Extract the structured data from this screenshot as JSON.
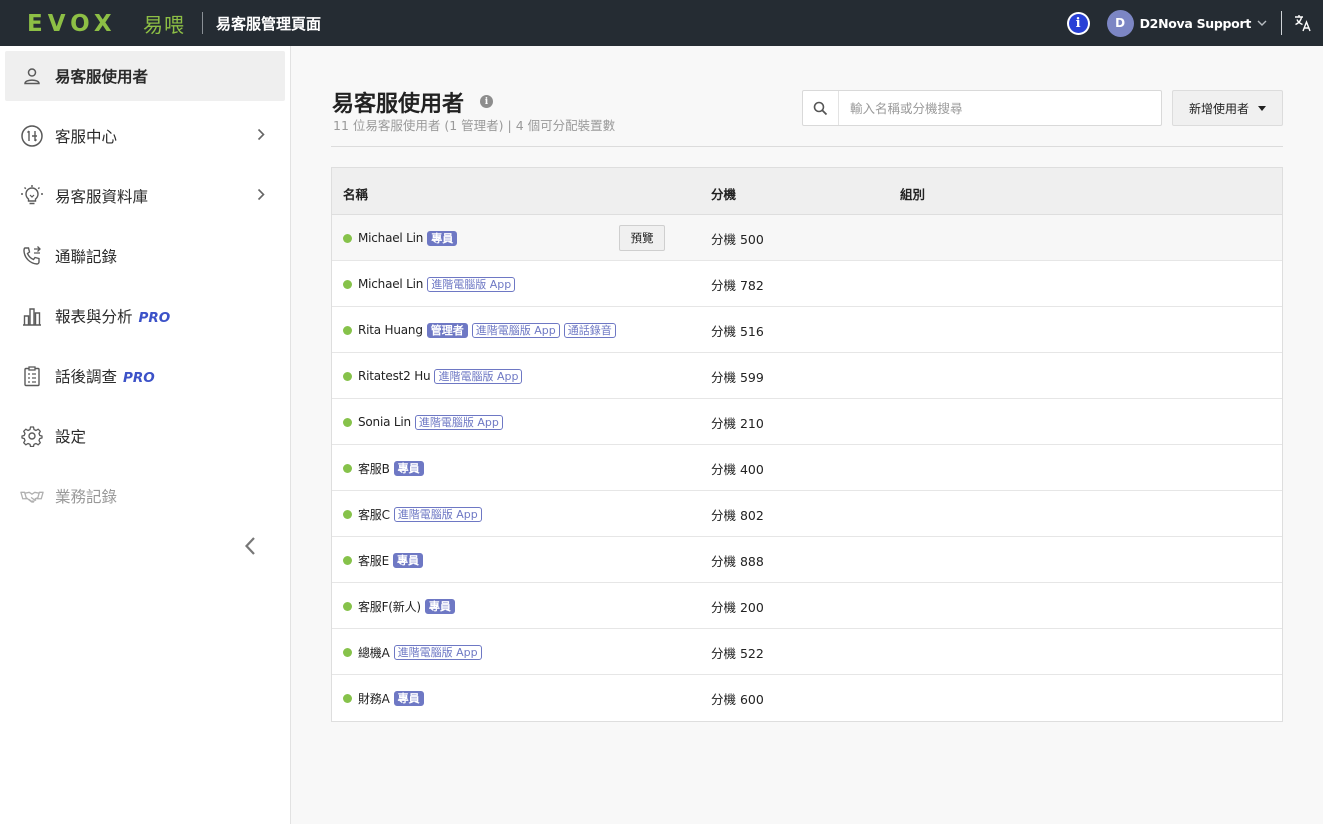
{
  "header": {
    "logo_text": "EVOX",
    "logo_cn": "易喂",
    "app_title": "易客服管理頁面",
    "info_symbol": "i",
    "user": {
      "initial": "D",
      "name": "D2Nova Support"
    },
    "icons": [
      "info-icon",
      "chevron-down-icon",
      "translate-icon"
    ],
    "brand_color": "#8dbf45",
    "bar_color": "#252c33"
  },
  "sidebar": {
    "items": [
      {
        "label": "易客服使用者",
        "icon": "user-icon",
        "active": true
      },
      {
        "label": "客服中心",
        "icon": "call-center-icon",
        "chevron": true
      },
      {
        "label": "易客服資料庫",
        "icon": "lightbulb-icon",
        "chevron": true
      },
      {
        "label": "通聯記錄",
        "icon": "phone-log-icon"
      },
      {
        "label": "報表與分析",
        "icon": "bar-chart-icon",
        "pro": "PRO"
      },
      {
        "label": "話後調查",
        "icon": "survey-clipboard-icon",
        "pro": "PRO"
      },
      {
        "label": "設定",
        "icon": "gear-icon"
      },
      {
        "label": "業務記錄",
        "icon": "handshake-icon",
        "disabled": true
      }
    ],
    "collapse_icon": "chevron-left-icon"
  },
  "main": {
    "title": "易客服使用者",
    "title_info_symbol": "i",
    "subtitle": "11 位易客服使用者 (1 管理者) | 4 個可分配裝置數",
    "search": {
      "placeholder": "輸入名稱或分機搜尋",
      "value": ""
    },
    "add_button": "新增使用者",
    "table": {
      "columns": [
        "名稱",
        "分機",
        "組別"
      ],
      "preview_label": "預覽",
      "rows": [
        {
          "name": "Michael Lin",
          "tags": [
            {
              "text": "專員",
              "style": "filled"
            }
          ],
          "ext": "分機 500",
          "preview": true
        },
        {
          "name": "Michael Lin",
          "tags": [
            {
              "text": "進階電腦版 App",
              "style": "outline"
            }
          ],
          "ext": "分機 782"
        },
        {
          "name": "Rita Huang",
          "tags": [
            {
              "text": "管理者",
              "style": "filled"
            },
            {
              "text": "進階電腦版 App",
              "style": "outline"
            },
            {
              "text": "通話錄音",
              "style": "outline"
            }
          ],
          "ext": "分機 516"
        },
        {
          "name": "Ritatest2 Hu",
          "tags": [
            {
              "text": "進階電腦版 App",
              "style": "outline"
            }
          ],
          "ext": "分機 599"
        },
        {
          "name": "Sonia Lin",
          "tags": [
            {
              "text": "進階電腦版 App",
              "style": "outline"
            }
          ],
          "ext": "分機 210"
        },
        {
          "name": "客服B",
          "tags": [
            {
              "text": "專員",
              "style": "filled"
            }
          ],
          "ext": "分機 400"
        },
        {
          "name": "客服C",
          "tags": [
            {
              "text": "進階電腦版 App",
              "style": "outline"
            }
          ],
          "ext": "分機 802"
        },
        {
          "name": "客服E",
          "tags": [
            {
              "text": "專員",
              "style": "filled"
            }
          ],
          "ext": "分機 888"
        },
        {
          "name": "客服F(新人)",
          "tags": [
            {
              "text": "專員",
              "style": "filled"
            }
          ],
          "ext": "分機 200"
        },
        {
          "name": "總機A",
          "tags": [
            {
              "text": "進階電腦版 App",
              "style": "outline"
            }
          ],
          "ext": "分機 522"
        },
        {
          "name": "財務A",
          "tags": [
            {
              "text": "專員",
              "style": "filled"
            }
          ],
          "ext": "分機 600"
        }
      ]
    },
    "status_color": "#86c24a",
    "tag_color": "#6e78c4"
  }
}
